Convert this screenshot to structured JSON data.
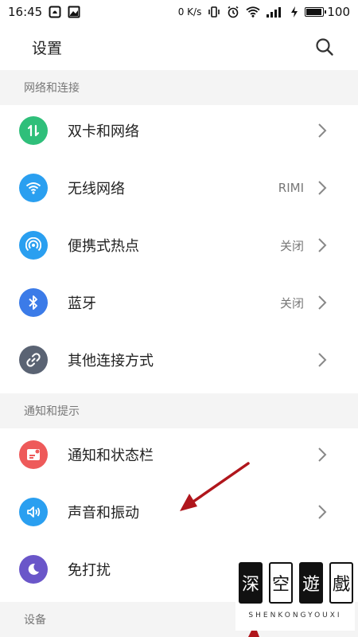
{
  "status_bar": {
    "time": "16:45",
    "net_speed": "0 K/s",
    "battery_level": "100",
    "battery_fraction": 1.0,
    "left_icons": [
      "notification-icon",
      "image-icon"
    ],
    "right_icons": [
      "vibrate-icon",
      "alarm-icon",
      "wifi-icon",
      "signal-icon",
      "charging-icon"
    ]
  },
  "header": {
    "title": "设置",
    "search_icon": "search-icon"
  },
  "sections": [
    {
      "title": "网络和连接",
      "items": [
        {
          "label": "双卡和网络",
          "value": "",
          "icon": "dual-sim-icon",
          "color": "#2fbf7a"
        },
        {
          "label": "无线网络",
          "value": "RIMI",
          "icon": "wifi-icon",
          "color": "#2a9ff0"
        },
        {
          "label": "便携式热点",
          "value": "关闭",
          "icon": "hotspot-icon",
          "color": "#2a9ff0"
        },
        {
          "label": "蓝牙",
          "value": "关闭",
          "icon": "bluetooth-icon",
          "color": "#3b7be8"
        },
        {
          "label": "其他连接方式",
          "value": "",
          "icon": "link-icon",
          "color": "#5a6373"
        }
      ]
    },
    {
      "title": "通知和提示",
      "items": [
        {
          "label": "通知和状态栏",
          "value": "",
          "icon": "notification-bar-icon",
          "color": "#ee5a5a"
        },
        {
          "label": "声音和振动",
          "value": "",
          "icon": "sound-icon",
          "color": "#2a9ff0"
        },
        {
          "label": "免打扰",
          "value": "",
          "icon": "moon-icon",
          "color": "#6a56c9"
        }
      ]
    },
    {
      "title": "设备",
      "items": []
    }
  ],
  "annotation": {
    "color": "#b0161c"
  },
  "watermark": {
    "chars": [
      "深",
      "空",
      "遊",
      "戲"
    ],
    "text": "SHENKONGYOUXI"
  }
}
